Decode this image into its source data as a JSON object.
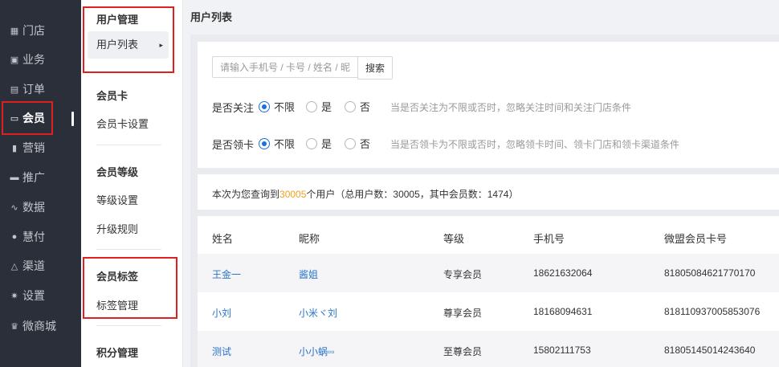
{
  "nav": {
    "items": [
      {
        "label": "门店",
        "icon": "store-icon",
        "glyph": "▦"
      },
      {
        "label": "业务",
        "icon": "briefcase-icon",
        "glyph": "▣"
      },
      {
        "label": "订单",
        "icon": "order-icon",
        "glyph": "▤"
      },
      {
        "label": "会员",
        "icon": "vip-card-icon",
        "glyph": "▭"
      },
      {
        "label": "营销",
        "icon": "bar-chart-icon",
        "glyph": "▮"
      },
      {
        "label": "推广",
        "icon": "monitor-icon",
        "glyph": "▬"
      },
      {
        "label": "数据",
        "icon": "line-chart-icon",
        "glyph": "∿"
      },
      {
        "label": "慧付",
        "icon": "pay-icon",
        "glyph": "●"
      },
      {
        "label": "渠道",
        "icon": "channel-icon",
        "glyph": "△"
      },
      {
        "label": "设置",
        "icon": "gear-icon",
        "glyph": "✷"
      },
      {
        "label": "微商城",
        "icon": "mall-icon",
        "glyph": "♛"
      }
    ],
    "active": "会员"
  },
  "subnav": {
    "groups": [
      {
        "title": "用户管理",
        "items": [
          "用户列表"
        ]
      },
      {
        "title": "会员卡",
        "items": [
          "会员卡设置"
        ]
      },
      {
        "title": "会员等级",
        "items": [
          "等级设置",
          "升级规则"
        ]
      },
      {
        "title": "会员标签",
        "items": [
          "标签管理"
        ]
      },
      {
        "title": "积分管理",
        "items": []
      }
    ],
    "selected": "用户列表",
    "caret": "▸"
  },
  "page": {
    "title": "用户列表"
  },
  "search": {
    "placeholder": "请输入手机号 / 卡号 / 姓名 / 昵称",
    "value": "",
    "button": "搜索"
  },
  "filters": {
    "follow": {
      "label": "是否关注",
      "options": [
        "不限",
        "是",
        "否"
      ],
      "selected": "不限",
      "hint": "当是否关注为不限或否时，忽略关注时间和关注门店条件"
    },
    "card": {
      "label": "是否领卡",
      "options": [
        "不限",
        "是",
        "否"
      ],
      "selected": "不限",
      "hint": "当是否领卡为不限或否时，忽略领卡时间、领卡门店和领卡渠道条件"
    }
  },
  "summary": {
    "prefix": "本次为您查询到",
    "count": "30005",
    "suffix": "个用户（总用户数：30005，其中会员数：1474）"
  },
  "table": {
    "columns": [
      "姓名",
      "昵称",
      "等级",
      "手机号",
      "微盟会员卡号"
    ],
    "rows": [
      [
        "王金一",
        "酱姐",
        "专享会员",
        "18621632064",
        "81805084621770170"
      ],
      [
        "小刘",
        "小米ヾ刘",
        "尊享会员",
        "18168094631",
        "818110937005853076"
      ],
      [
        "测试",
        "小小蜗▫▫",
        "至尊会员",
        "15802111753",
        "81805145014243640"
      ]
    ]
  },
  "colors": {
    "nav_bg": "#2b2f3a",
    "accent": "#1e6fd9",
    "link": "#2a74c9",
    "highlight": "#f0a020",
    "annotation": "#e02020"
  }
}
